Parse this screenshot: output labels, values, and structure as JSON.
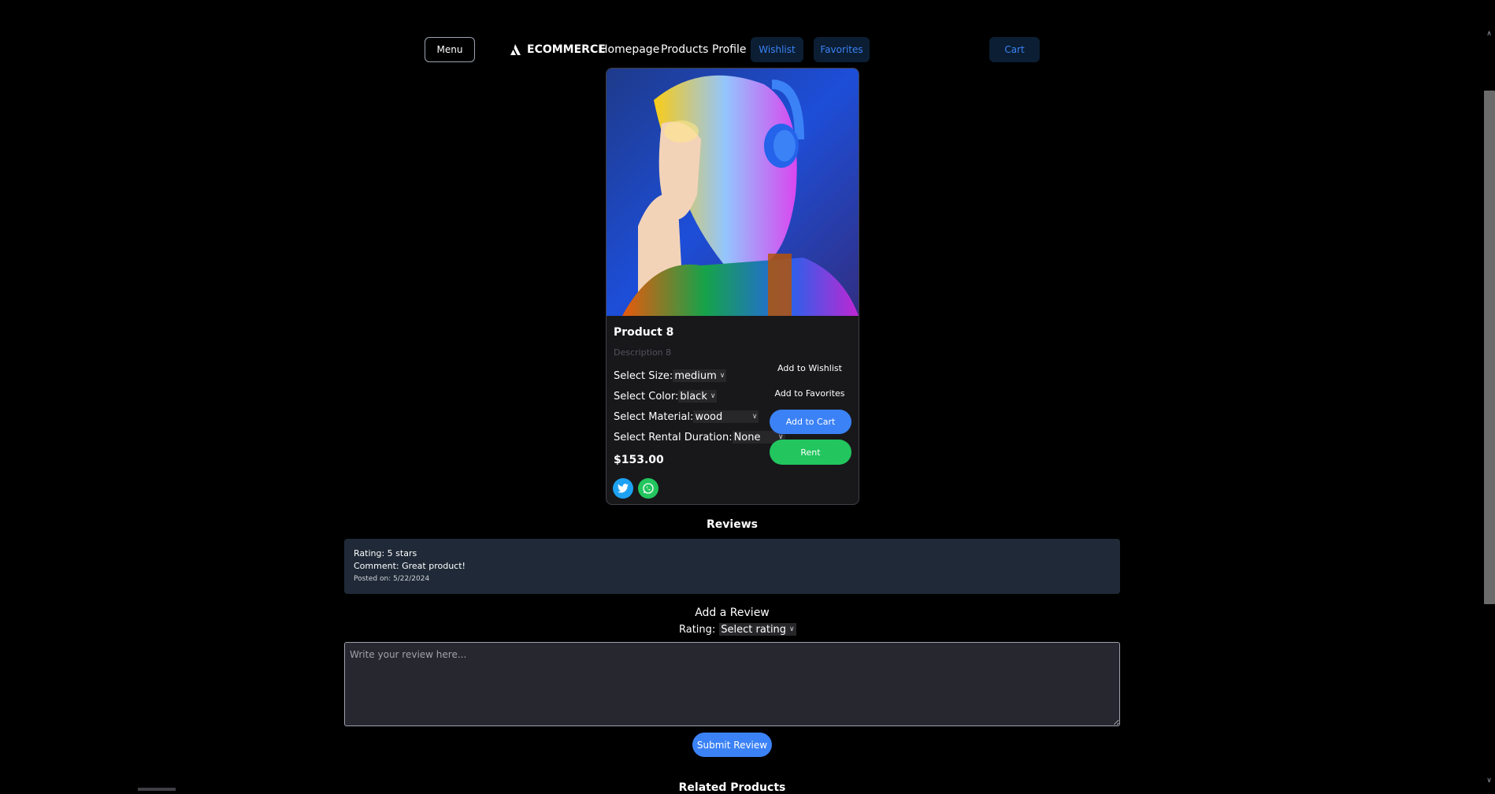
{
  "header": {
    "menu_label": "Menu",
    "brand": "ECOMMERCE",
    "nav": [
      "Homepage",
      "Products",
      "Profile"
    ],
    "wishlist_label": "Wishlist",
    "favorites_label": "Favorites",
    "cart_label": "Cart"
  },
  "product": {
    "title": "Product 8",
    "description": "Description 8",
    "size_label": "Select Size:",
    "size_value": "medium",
    "color_label": "Select Color:",
    "color_value": "black",
    "material_label": "Select Material:",
    "material_value": "wood",
    "rental_label": "Select Rental Duration:",
    "rental_value": "None",
    "price": "$153.00",
    "add_wishlist": "Add to Wishlist",
    "add_favorites": "Add to Favorites",
    "add_cart": "Add to Cart",
    "rent": "Rent"
  },
  "reviews": {
    "heading": "Reviews",
    "items": [
      {
        "rating": "Rating: 5 stars",
        "comment": "Comment: Great product!",
        "posted": "Posted on: 5/22/2024"
      }
    ]
  },
  "add_review": {
    "heading": "Add a Review",
    "rating_label": "Rating:",
    "rating_value": "Select rating",
    "placeholder": "Write your review here...",
    "submit": "Submit Review"
  },
  "related": {
    "heading": "Related Products"
  },
  "colors": {
    "accent_blue": "#3b82f6",
    "rent_green": "#22c55e",
    "twitter": "#1da1f2",
    "whatsapp": "#25d366"
  }
}
